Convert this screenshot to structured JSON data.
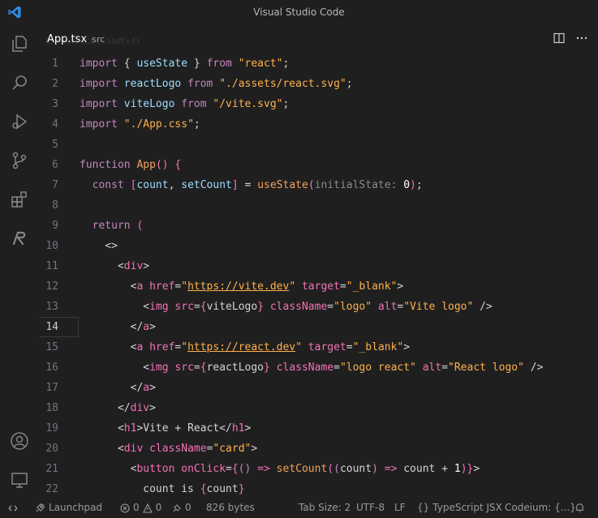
{
  "window": {
    "title": "Visual Studio Code"
  },
  "activity_bar": {
    "items": [
      {
        "name": "explorer-icon"
      },
      {
        "name": "search-icon"
      },
      {
        "name": "run-debug-icon"
      },
      {
        "name": "source-control-icon"
      },
      {
        "name": "extensions-icon"
      },
      {
        "name": "codeium-icon"
      },
      {
        "name": "accounts-icon"
      },
      {
        "name": "remote-icon"
      }
    ]
  },
  "tab": {
    "filename": "App.tsx",
    "description": "src",
    "hint": "Explorer (Ctrl+Shift+E)"
  },
  "editor": {
    "active_line": "14",
    "lines": [
      {
        "num": "1",
        "segs": [
          [
            "kw",
            "import"
          ],
          [
            "tx",
            " { "
          ],
          [
            "va",
            "useState"
          ],
          [
            "tx",
            " } "
          ],
          [
            "kw",
            "from"
          ],
          [
            "tx",
            " "
          ],
          [
            "st",
            "\"react\""
          ],
          [
            "tx",
            ";"
          ]
        ]
      },
      {
        "num": "2",
        "segs": [
          [
            "kw",
            "import"
          ],
          [
            "tx",
            " "
          ],
          [
            "va",
            "reactLogo"
          ],
          [
            "tx",
            " "
          ],
          [
            "kw",
            "from"
          ],
          [
            "tx",
            " "
          ],
          [
            "st",
            "\"./assets/react.svg\""
          ],
          [
            "tx",
            ";"
          ]
        ]
      },
      {
        "num": "3",
        "segs": [
          [
            "kw",
            "import"
          ],
          [
            "tx",
            " "
          ],
          [
            "va",
            "viteLogo"
          ],
          [
            "tx",
            " "
          ],
          [
            "kw",
            "from"
          ],
          [
            "tx",
            " "
          ],
          [
            "st",
            "\"/vite.svg\""
          ],
          [
            "tx",
            ";"
          ]
        ]
      },
      {
        "num": "4",
        "segs": [
          [
            "kw",
            "import"
          ],
          [
            "tx",
            " "
          ],
          [
            "st",
            "\"./App.css\""
          ],
          [
            "tx",
            ";"
          ]
        ]
      },
      {
        "num": "5",
        "segs": []
      },
      {
        "num": "6",
        "segs": [
          [
            "kw",
            "function"
          ],
          [
            "tx",
            " "
          ],
          [
            "fn",
            "App"
          ],
          [
            "br",
            "()"
          ],
          [
            "tx",
            " "
          ],
          [
            "br",
            "{"
          ]
        ]
      },
      {
        "num": "7",
        "segs": [
          [
            "tx",
            "  "
          ],
          [
            "kw",
            "const"
          ],
          [
            "tx",
            " "
          ],
          [
            "br",
            "["
          ],
          [
            "va",
            "count"
          ],
          [
            "tx",
            ", "
          ],
          [
            "va",
            "setCount"
          ],
          [
            "br",
            "]"
          ],
          [
            "tx",
            " = "
          ],
          [
            "fn",
            "useState"
          ],
          [
            "br",
            "("
          ],
          [
            "hint",
            "initialState:"
          ],
          [
            "tx",
            " "
          ],
          [
            "num",
            "0"
          ],
          [
            "br",
            ")"
          ],
          [
            "tx",
            ";"
          ]
        ]
      },
      {
        "num": "8",
        "segs": []
      },
      {
        "num": "9",
        "segs": [
          [
            "tx",
            "  "
          ],
          [
            "kw",
            "return"
          ],
          [
            "tx",
            " "
          ],
          [
            "br",
            "("
          ]
        ]
      },
      {
        "num": "10",
        "segs": [
          [
            "tx",
            "    "
          ],
          [
            "tx",
            "<>"
          ]
        ]
      },
      {
        "num": "11",
        "segs": [
          [
            "tx",
            "      "
          ],
          [
            "tx",
            "<"
          ],
          [
            "tg",
            "div"
          ],
          [
            "tx",
            ">"
          ]
        ]
      },
      {
        "num": "12",
        "segs": [
          [
            "tx",
            "        "
          ],
          [
            "tx",
            "<"
          ],
          [
            "tg",
            "a"
          ],
          [
            "tx",
            " "
          ],
          [
            "at",
            "href"
          ],
          [
            "tx",
            "="
          ],
          [
            "st",
            "\""
          ],
          [
            "url",
            "https://vite.dev"
          ],
          [
            "st",
            "\""
          ],
          [
            "tx",
            " "
          ],
          [
            "at",
            "target"
          ],
          [
            "tx",
            "="
          ],
          [
            "st",
            "\"_blank\""
          ],
          [
            "tx",
            ">"
          ]
        ]
      },
      {
        "num": "13",
        "segs": [
          [
            "tx",
            "          "
          ],
          [
            "tx",
            "<"
          ],
          [
            "tg",
            "img"
          ],
          [
            "tx",
            " "
          ],
          [
            "at",
            "src"
          ],
          [
            "tx",
            "="
          ],
          [
            "br",
            "{"
          ],
          [
            "tx",
            "viteLogo"
          ],
          [
            "br",
            "}"
          ],
          [
            "tx",
            " "
          ],
          [
            "at",
            "className"
          ],
          [
            "tx",
            "="
          ],
          [
            "st",
            "\"logo\""
          ],
          [
            "tx",
            " "
          ],
          [
            "at",
            "alt"
          ],
          [
            "tx",
            "="
          ],
          [
            "st",
            "\"Vite logo\""
          ],
          [
            "tx",
            " />"
          ]
        ]
      },
      {
        "num": "14",
        "segs": [
          [
            "tx",
            "        "
          ],
          [
            "tx",
            "</"
          ],
          [
            "tg",
            "a"
          ],
          [
            "tx",
            ">"
          ]
        ]
      },
      {
        "num": "15",
        "segs": [
          [
            "tx",
            "        "
          ],
          [
            "tx",
            "<"
          ],
          [
            "tg",
            "a"
          ],
          [
            "tx",
            " "
          ],
          [
            "at",
            "href"
          ],
          [
            "tx",
            "="
          ],
          [
            "st",
            "\""
          ],
          [
            "url",
            "https://react.dev"
          ],
          [
            "st",
            "\""
          ],
          [
            "tx",
            " "
          ],
          [
            "at",
            "target"
          ],
          [
            "tx",
            "="
          ],
          [
            "st",
            "\"_blank\""
          ],
          [
            "tx",
            ">"
          ]
        ]
      },
      {
        "num": "16",
        "segs": [
          [
            "tx",
            "          "
          ],
          [
            "tx",
            "<"
          ],
          [
            "tg",
            "img"
          ],
          [
            "tx",
            " "
          ],
          [
            "at",
            "src"
          ],
          [
            "tx",
            "="
          ],
          [
            "br",
            "{"
          ],
          [
            "tx",
            "reactLogo"
          ],
          [
            "br",
            "}"
          ],
          [
            "tx",
            " "
          ],
          [
            "at",
            "className"
          ],
          [
            "tx",
            "="
          ],
          [
            "st",
            "\"logo react\""
          ],
          [
            "tx",
            " "
          ],
          [
            "at",
            "alt"
          ],
          [
            "tx",
            "="
          ],
          [
            "st",
            "\"React logo\""
          ],
          [
            "tx",
            " />"
          ]
        ]
      },
      {
        "num": "17",
        "segs": [
          [
            "tx",
            "        "
          ],
          [
            "tx",
            "</"
          ],
          [
            "tg",
            "a"
          ],
          [
            "tx",
            ">"
          ]
        ]
      },
      {
        "num": "18",
        "segs": [
          [
            "tx",
            "      "
          ],
          [
            "tx",
            "</"
          ],
          [
            "tg",
            "div"
          ],
          [
            "tx",
            ">"
          ]
        ]
      },
      {
        "num": "19",
        "segs": [
          [
            "tx",
            "      "
          ],
          [
            "tx",
            "<"
          ],
          [
            "tg",
            "h1"
          ],
          [
            "tx",
            ">Vite + React</"
          ],
          [
            "tg",
            "h1"
          ],
          [
            "tx",
            ">"
          ]
        ]
      },
      {
        "num": "20",
        "segs": [
          [
            "tx",
            "      "
          ],
          [
            "tx",
            "<"
          ],
          [
            "tg",
            "div"
          ],
          [
            "tx",
            " "
          ],
          [
            "at",
            "className"
          ],
          [
            "tx",
            "="
          ],
          [
            "st",
            "\"card\""
          ],
          [
            "tx",
            ">"
          ]
        ]
      },
      {
        "num": "21",
        "segs": [
          [
            "tx",
            "        "
          ],
          [
            "tx",
            "<"
          ],
          [
            "tg",
            "button"
          ],
          [
            "tx",
            " "
          ],
          [
            "at",
            "onClick"
          ],
          [
            "tx",
            "="
          ],
          [
            "br",
            "{"
          ],
          [
            "kw",
            "()"
          ],
          [
            "tx",
            " "
          ],
          [
            "at",
            "=>"
          ],
          [
            "tx",
            " "
          ],
          [
            "fn",
            "setCount"
          ],
          [
            "br",
            "("
          ],
          [
            "kw",
            "("
          ],
          [
            "tx",
            "count"
          ],
          [
            "kw",
            ")"
          ],
          [
            "tx",
            " "
          ],
          [
            "at",
            "=>"
          ],
          [
            "tx",
            " count + "
          ],
          [
            "num",
            "1"
          ],
          [
            "br",
            ")"
          ],
          [
            "br",
            "}"
          ],
          [
            "tx",
            ">"
          ]
        ]
      },
      {
        "num": "22",
        "segs": [
          [
            "tx",
            "          count is "
          ],
          [
            "br",
            "{"
          ],
          [
            "tx",
            "count"
          ],
          [
            "br",
            "}"
          ]
        ]
      }
    ]
  },
  "status_bar": {
    "launchpad": "Launchpad",
    "errors": "0",
    "warnings": "0",
    "ports": "0",
    "size": "826 bytes",
    "tab_size": "Tab Size: 2",
    "encoding": "UTF-8",
    "eol": "LF",
    "language": "TypeScript JSX",
    "codeium": "Codeium: {...}"
  },
  "colors": {
    "background": "#1f1f1f",
    "keyword": "#c586c0",
    "string": "#ffb04d",
    "tag": "#f472b6",
    "accent": "#0078d4"
  }
}
